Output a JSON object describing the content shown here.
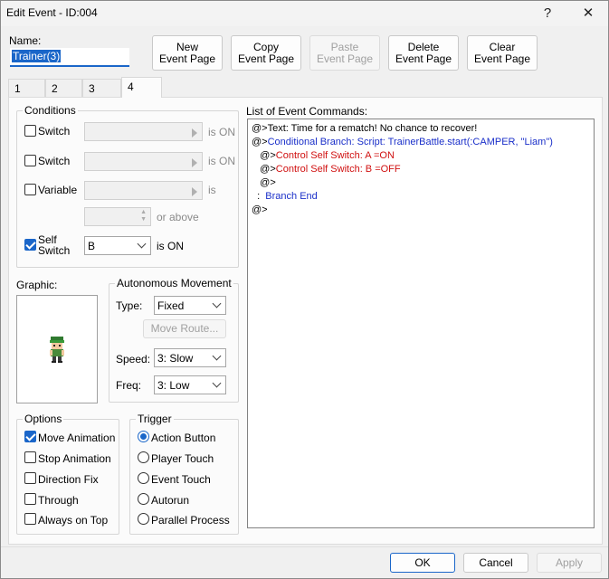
{
  "window": {
    "title": "Edit Event - ID:004",
    "help": "?",
    "close": "✕"
  },
  "name": {
    "label": "Name:",
    "value": "Trainer(3)"
  },
  "toolbar": {
    "new_page": [
      "New",
      "Event Page"
    ],
    "copy_page": [
      "Copy",
      "Event Page"
    ],
    "paste_page": [
      "Paste",
      "Event Page"
    ],
    "delete_page": [
      "Delete",
      "Event Page"
    ],
    "clear_page": [
      "Clear",
      "Event Page"
    ]
  },
  "tabs": [
    "1",
    "2",
    "3",
    "4"
  ],
  "active_tab": "4",
  "conditions": {
    "label": "Conditions",
    "switch1": {
      "label": "Switch",
      "suffix": "is ON",
      "checked": false
    },
    "switch2": {
      "label": "Switch",
      "suffix": "is ON",
      "checked": false
    },
    "variable": {
      "label": "Variable",
      "suffix": "is",
      "checked": false,
      "or_above": "or above"
    },
    "self_switch": {
      "label": [
        "Self",
        "Switch"
      ],
      "value": "B",
      "suffix": "is ON",
      "checked": true
    }
  },
  "graphic": {
    "label": "Graphic:"
  },
  "autonomous": {
    "label": "Autonomous Movement",
    "type_label": "Type:",
    "type_value": "Fixed",
    "move_route": "Move Route...",
    "speed_label": "Speed:",
    "speed_value": "3: Slow",
    "freq_label": "Freq:",
    "freq_value": "3: Low"
  },
  "options": {
    "label": "Options",
    "items": [
      {
        "label": "Move Animation",
        "checked": true
      },
      {
        "label": "Stop Animation",
        "checked": false
      },
      {
        "label": "Direction Fix",
        "checked": false
      },
      {
        "label": "Through",
        "checked": false
      },
      {
        "label": "Always on Top",
        "checked": false
      }
    ]
  },
  "trigger": {
    "label": "Trigger",
    "items": [
      {
        "label": "Action Button",
        "selected": true
      },
      {
        "label": "Player Touch",
        "selected": false
      },
      {
        "label": "Event Touch",
        "selected": false
      },
      {
        "label": "Autorun",
        "selected": false
      },
      {
        "label": "Parallel Process",
        "selected": false
      }
    ]
  },
  "commands": {
    "label": "List of Event Commands:",
    "lines": [
      {
        "prefix": "@>",
        "text": "Text: Time for a rematch! No chance to recover!",
        "color": "#000000"
      },
      {
        "prefix": "@>",
        "text": "Conditional Branch: Script: TrainerBattle.start(:CAMPER, \"Liam\")",
        "color": "#1a2fc9"
      },
      {
        "prefix": "   @>",
        "text": "Control Self Switch: A =ON",
        "color": "#d01010"
      },
      {
        "prefix": "   @>",
        "text": "Control Self Switch: B =OFF",
        "color": "#d01010"
      },
      {
        "prefix": "   @>",
        "text": "",
        "color": "#000000"
      },
      {
        "prefix": "  :  ",
        "text": "Branch End",
        "color": "#1a2fc9"
      },
      {
        "prefix": "@>",
        "text": "",
        "color": "#000000"
      }
    ]
  },
  "footer": {
    "ok": "OK",
    "cancel": "Cancel",
    "apply": "Apply"
  }
}
